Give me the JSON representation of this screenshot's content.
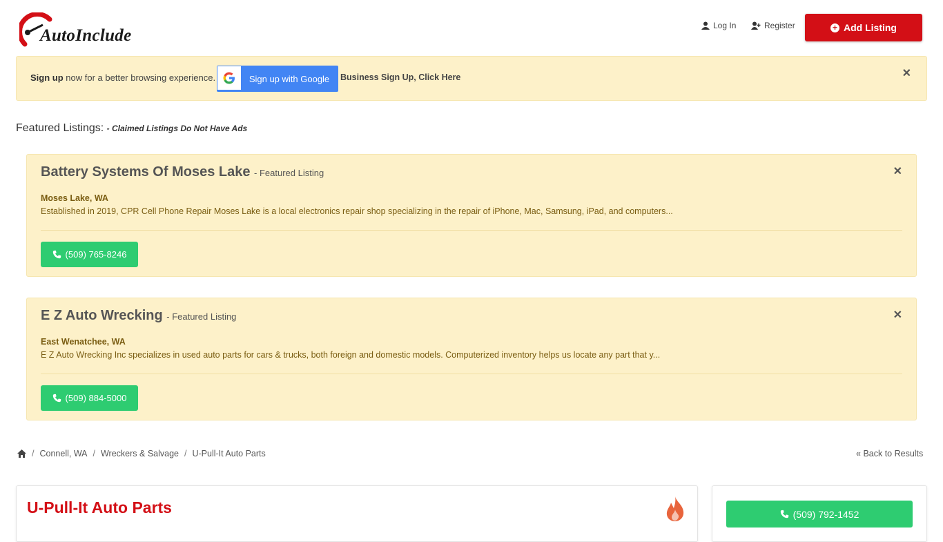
{
  "header": {
    "logo_text": "AutoInclude",
    "login_label": "Log In",
    "register_label": "Register",
    "add_listing_label": "Add Listing"
  },
  "banner": {
    "signup_bold": "Sign up",
    "signup_rest": "now for a better browsing experience.",
    "google_label": "Sign up with Google",
    "business_link": "Business Sign Up, Click Here"
  },
  "featured": {
    "heading": "Featured Listings:",
    "subheading": "- Claimed Listings Do Not Have Ads",
    "cards": [
      {
        "title": "Battery Systems Of Moses Lake",
        "tag": "- Featured Listing",
        "location": "Moses Lake, WA",
        "description": "Established in 2019, CPR Cell Phone Repair Moses Lake is a local electronics repair shop specializing in the repair of iPhone, Mac, Samsung, iPad, and computers...",
        "phone": "(509) 765-8246"
      },
      {
        "title": "E Z Auto Wrecking",
        "tag": "- Featured Listing",
        "location": "East Wenatchee, WA",
        "description": "E Z Auto Wrecking Inc specializes in used auto parts for cars & trucks, both foreign and domestic models. Computerized inventory helps us locate any part that y...",
        "phone": "(509) 884-5000"
      }
    ]
  },
  "breadcrumb": {
    "items": [
      "Connell, WA",
      "Wreckers & Salvage",
      "U-Pull-It Auto Parts"
    ],
    "back_label": "Back to Results"
  },
  "listing": {
    "title": "U-Pull-It Auto Parts",
    "phone": "(509) 792-1452"
  },
  "colors": {
    "brand_red": "#d30f16",
    "phone_green": "#2ecc71",
    "banner_bg": "#fdf1c9",
    "google_blue": "#4285f4"
  },
  "icons": {
    "login": "user-icon",
    "register": "user-plus-icon",
    "add": "plus-circle-icon",
    "close": "close-icon",
    "phone": "phone-icon",
    "home": "home-icon",
    "back": "double-chevron-left-icon",
    "hot": "fire-icon"
  }
}
